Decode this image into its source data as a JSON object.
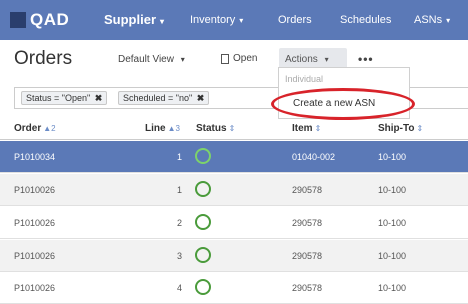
{
  "topbar": {
    "logo_text": "QAD",
    "nav": [
      {
        "label": "Supplier",
        "caret": "▾"
      },
      {
        "label": "Inventory",
        "caret": "▾"
      },
      {
        "label": "Orders",
        "caret": ""
      },
      {
        "label": "Schedules",
        "caret": ""
      },
      {
        "label": "ASNs",
        "caret": "▾"
      }
    ]
  },
  "toolbar": {
    "title": "Orders",
    "view_label": "Default View",
    "view_caret": "▾",
    "open_label": "Open",
    "actions_label": "Actions",
    "actions_caret": "▾",
    "more_label": "•••"
  },
  "filters": [
    {
      "label": "Status = \"Open\"",
      "remove": "✖"
    },
    {
      "label": "Scheduled = \"no\"",
      "remove": "✖"
    }
  ],
  "actions_menu": {
    "group_label": "Individual",
    "items": [
      "Create a new ASN"
    ]
  },
  "table": {
    "columns": [
      {
        "label": "Order",
        "sort": "▲2"
      },
      {
        "label": "Line",
        "sort": "▲3"
      },
      {
        "label": "Status",
        "sort": "⇕"
      },
      {
        "label": "Item",
        "sort": "⇕"
      },
      {
        "label": "Ship-To",
        "sort": "⇕"
      }
    ],
    "rows": [
      {
        "order": "P1010034",
        "line": "1",
        "item": "01040-002",
        "ship_to": "10-100",
        "selected": true
      },
      {
        "order": "P1010026",
        "line": "1",
        "item": "290578",
        "ship_to": "10-100",
        "selected": false
      },
      {
        "order": "P1010026",
        "line": "2",
        "item": "290578",
        "ship_to": "10-100",
        "selected": false
      },
      {
        "order": "P1010026",
        "line": "3",
        "item": "290578",
        "ship_to": "10-100",
        "selected": false
      },
      {
        "order": "P1010026",
        "line": "4",
        "item": "290578",
        "ship_to": "10-100",
        "selected": false
      }
    ]
  },
  "colors": {
    "nav_bg": "#5b79b7",
    "selected_row": "#5b79b7",
    "status_open": "#4a9b3b",
    "highlight_ring": "#d8232a"
  }
}
